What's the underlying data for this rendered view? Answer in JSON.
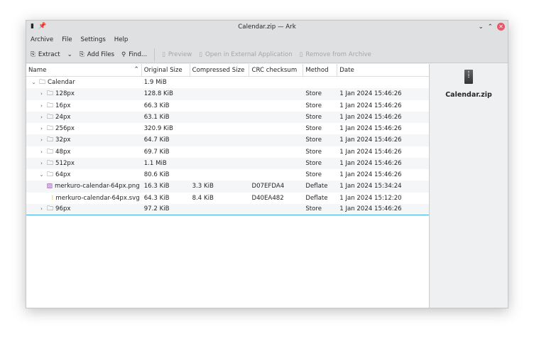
{
  "window": {
    "title": "Calendar.zip — Ark"
  },
  "menu": [
    "Archive",
    "File",
    "Settings",
    "Help"
  ],
  "toolbar": {
    "extract": "Extract",
    "add_files": "Add Files",
    "find": "Find...",
    "preview": "Preview",
    "open_external": "Open in External Application",
    "remove": "Remove from Archive"
  },
  "columns": [
    "Name",
    "Original Size",
    "Compressed Size",
    "CRC checksum",
    "Method",
    "Date"
  ],
  "rows": [
    {
      "name": "Calendar",
      "level": 0,
      "type": "folder",
      "expanded": true,
      "orig": "1.9 MiB",
      "comp": "",
      "crc": "",
      "method": "",
      "date": ""
    },
    {
      "name": "128px",
      "level": 1,
      "type": "folder",
      "expanded": false,
      "orig": "128.8 KiB",
      "comp": "",
      "crc": "",
      "method": "Store",
      "date": "1 Jan 2024 15:46:26"
    },
    {
      "name": "16px",
      "level": 1,
      "type": "folder",
      "expanded": false,
      "orig": "66.3 KiB",
      "comp": "",
      "crc": "",
      "method": "Store",
      "date": "1 Jan 2024 15:46:26"
    },
    {
      "name": "24px",
      "level": 1,
      "type": "folder",
      "expanded": false,
      "orig": "63.1 KiB",
      "comp": "",
      "crc": "",
      "method": "Store",
      "date": "1 Jan 2024 15:46:26"
    },
    {
      "name": "256px",
      "level": 1,
      "type": "folder",
      "expanded": false,
      "orig": "320.9 KiB",
      "comp": "",
      "crc": "",
      "method": "Store",
      "date": "1 Jan 2024 15:46:26"
    },
    {
      "name": "32px",
      "level": 1,
      "type": "folder",
      "expanded": false,
      "orig": "64.7 KiB",
      "comp": "",
      "crc": "",
      "method": "Store",
      "date": "1 Jan 2024 15:46:26"
    },
    {
      "name": "48px",
      "level": 1,
      "type": "folder",
      "expanded": false,
      "orig": "69.7 KiB",
      "comp": "",
      "crc": "",
      "method": "Store",
      "date": "1 Jan 2024 15:46:26"
    },
    {
      "name": "512px",
      "level": 1,
      "type": "folder",
      "expanded": false,
      "orig": "1.1 MiB",
      "comp": "",
      "crc": "",
      "method": "Store",
      "date": "1 Jan 2024 15:46:26"
    },
    {
      "name": "64px",
      "level": 1,
      "type": "folder",
      "expanded": true,
      "orig": "80.6 KiB",
      "comp": "",
      "crc": "",
      "method": "Store",
      "date": "1 Jan 2024 15:46:26"
    },
    {
      "name": "merkuro-calendar-64px.png",
      "level": 2,
      "type": "png",
      "orig": "16.3 KiB",
      "comp": "3.3 KiB",
      "crc": "D07EFDA4",
      "method": "Deflate",
      "date": "1 Jan 2024 15:34:24"
    },
    {
      "name": "merkuro-calendar-64px.svg",
      "level": 2,
      "type": "svg",
      "orig": "64.3 KiB",
      "comp": "8.4 KiB",
      "crc": "D40EA482",
      "method": "Deflate",
      "date": "1 Jan 2024 15:12:20"
    },
    {
      "name": "96px",
      "level": 1,
      "type": "folder",
      "expanded": false,
      "orig": "97.2 KiB",
      "comp": "",
      "crc": "",
      "method": "Store",
      "date": "1 Jan 2024 15:46:26"
    }
  ],
  "side": {
    "filename": "Calendar.zip"
  }
}
